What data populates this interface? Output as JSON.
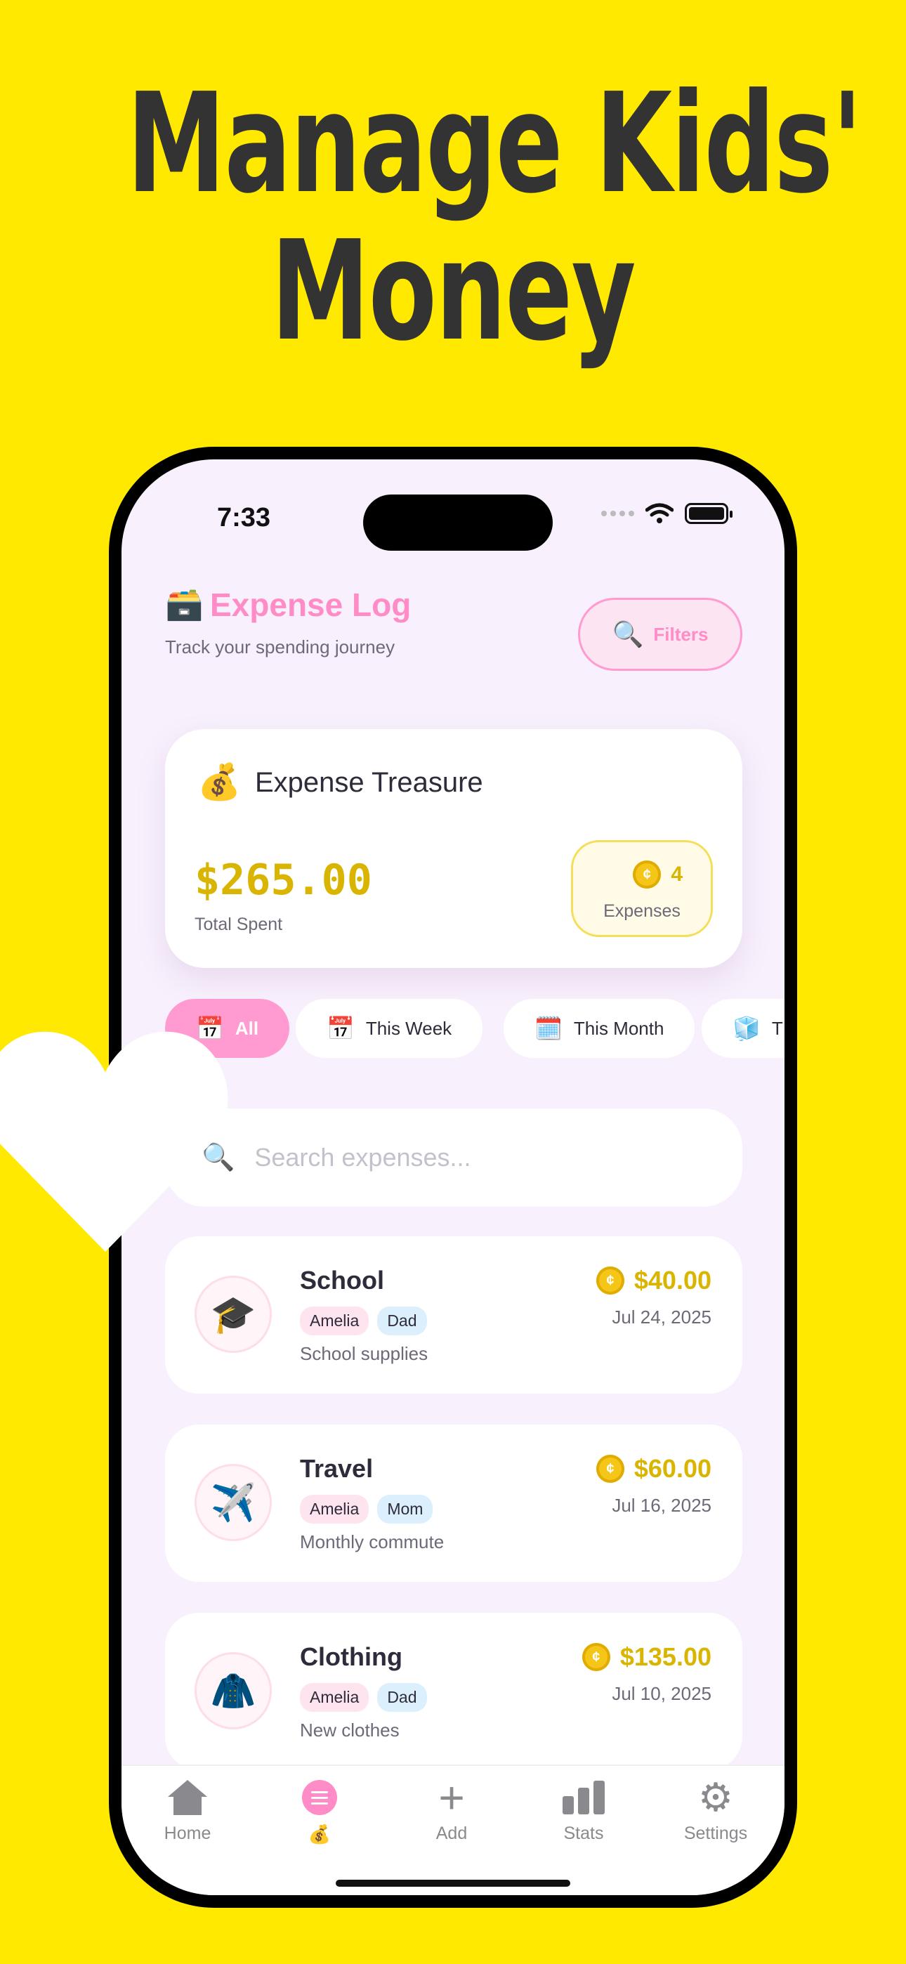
{
  "headline": {
    "line1": "Manage Kids'",
    "line2": "Money"
  },
  "status_bar": {
    "time": "7:33"
  },
  "header": {
    "emoji": "🗃️",
    "title": "Expense Log",
    "subtitle": "Track your spending journey",
    "filters_icon": "🔍",
    "filters_label": "Filters"
  },
  "treasure": {
    "emoji": "💰",
    "title": "Expense Treasure",
    "total": "$265.00",
    "total_label": "Total Spent",
    "count": "4",
    "count_label": "Expenses"
  },
  "chips": [
    {
      "emoji": "📅",
      "label": "All",
      "active": true
    },
    {
      "emoji": "📅",
      "label": "This Week"
    },
    {
      "emoji": "🗓️",
      "label": "This Month"
    },
    {
      "emoji": "🧊",
      "label": "T"
    }
  ],
  "search": {
    "icon": "🔍",
    "placeholder": "Search expenses..."
  },
  "expenses": [
    {
      "emoji": "🎓",
      "category": "School",
      "kid": "Amelia",
      "parent": "Dad",
      "note": "School supplies",
      "amount": "$40.00",
      "date": "Jul 24, 2025"
    },
    {
      "emoji": "✈️",
      "category": "Travel",
      "kid": "Amelia",
      "parent": "Mom",
      "note": "Monthly commute",
      "amount": "$60.00",
      "date": "Jul 16, 2025"
    },
    {
      "emoji": "🧥",
      "category": "Clothing",
      "kid": "Amelia",
      "parent": "Dad",
      "note": "New clothes",
      "amount": "$135.00",
      "date": "Jul 10, 2025"
    }
  ],
  "tabbar": {
    "home": "Home",
    "log_emoji": "💰",
    "add": "Add",
    "stats": "Stats",
    "settings": "Settings",
    "add_icon": "+",
    "settings_icon": "⚙"
  },
  "colors": {
    "background": "#FFE900",
    "pink": "#FF8CC6",
    "gold": "#D9B400",
    "screen": "#F8F0FC"
  }
}
